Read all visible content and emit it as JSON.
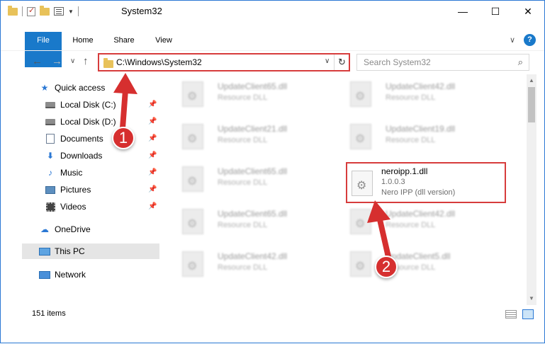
{
  "window": {
    "title": "System32",
    "minimize_glyph": "—",
    "maximize_glyph": "☐",
    "close_glyph": "✕"
  },
  "ribbon": {
    "tabs": [
      "File",
      "Home",
      "Share",
      "View"
    ],
    "expand_glyph": "∨",
    "help_glyph": "?"
  },
  "navigation": {
    "back_glyph": "←",
    "forward_glyph": "→",
    "recent_glyph": "∨",
    "up_glyph": "↑",
    "address": "C:\\Windows\\System32",
    "address_dropdown_glyph": "∨",
    "refresh_glyph": "↻",
    "search_placeholder": "Search System32",
    "search_glyph": "⌕"
  },
  "nav_pane": {
    "quick_access": "Quick access",
    "items": [
      {
        "label": "Local Disk (C:)",
        "icon": "drive-icon"
      },
      {
        "label": "Local Disk (D:)",
        "icon": "drive-icon"
      },
      {
        "label": "Documents",
        "icon": "documents-icon"
      },
      {
        "label": "Downloads",
        "icon": "downloads-icon"
      },
      {
        "label": "Music",
        "icon": "music-icon"
      },
      {
        "label": "Pictures",
        "icon": "pictures-icon"
      },
      {
        "label": "Videos",
        "icon": "videos-icon"
      }
    ],
    "onedrive": "OneDrive",
    "this_pc": "This PC",
    "network": "Network",
    "pin_glyph": "📌"
  },
  "files": [
    {
      "name": "UpdateClient65.dll",
      "type": "Resource DLL"
    },
    {
      "name": "UpdateClient42.dll",
      "type": "Resource DLL"
    },
    {
      "name": "UpdateClient21.dll",
      "type": "Resource DLL"
    },
    {
      "name": "UpdateClient19.dll",
      "type": "Resource DLL"
    },
    {
      "name": "UpdateClient65.dll",
      "type": "Resource DLL"
    },
    {
      "name": "UpdateClient65.dll",
      "type": "Resource DLL"
    },
    {
      "name": "UpdateClient42.dll",
      "type": "Resource DLL"
    },
    {
      "name": "UpdateClient42.dll",
      "type": "Resource DLL"
    },
    {
      "name": "UpdateClient5.dll",
      "type": "Resource DLL"
    }
  ],
  "highlighted_file": {
    "name": "neroipp.1.dll",
    "version": "1.0.0.3",
    "description": "Nero IPP (dll version)"
  },
  "status": {
    "item_count": "151 items"
  },
  "annotations": {
    "step1": "1",
    "step2": "2",
    "color": "#d62f2f"
  },
  "colors": {
    "accent": "#1979ca",
    "highlight_border": "#d73c3c"
  }
}
